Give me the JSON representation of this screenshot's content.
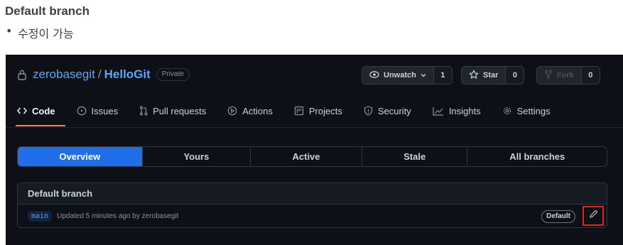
{
  "slide": {
    "heading": "Default branch",
    "bullet_marker": "•",
    "bullet": "수정이 가능"
  },
  "repo": {
    "owner": "zerobasegit",
    "separator": "/",
    "name": "HelloGit",
    "visibility": "Private",
    "lock_icon": "lock-icon"
  },
  "actions": {
    "watch": {
      "label": "Unwatch",
      "count": "1",
      "icon": "eye-icon"
    },
    "star": {
      "label": "Star",
      "count": "0",
      "icon": "star-icon"
    },
    "fork": {
      "label": "Fork",
      "count": "0",
      "icon": "fork-icon"
    }
  },
  "tabs": [
    {
      "label": "Code",
      "icon": "code-icon",
      "active": true
    },
    {
      "label": "Issues",
      "icon": "issue-icon"
    },
    {
      "label": "Pull requests",
      "icon": "pull-request-icon"
    },
    {
      "label": "Actions",
      "icon": "play-icon"
    },
    {
      "label": "Projects",
      "icon": "project-icon"
    },
    {
      "label": "Security",
      "icon": "shield-icon"
    },
    {
      "label": "Insights",
      "icon": "graph-icon"
    },
    {
      "label": "Settings",
      "icon": "gear-icon"
    }
  ],
  "branch_filters": [
    {
      "label": "Overview",
      "active": true
    },
    {
      "label": "Yours"
    },
    {
      "label": "Active"
    },
    {
      "label": "Stale"
    },
    {
      "label": "All branches"
    }
  ],
  "default_branch": {
    "header": "Default branch",
    "branch_name": "main",
    "updated": "Updated 5 minutes ago by zerobasegit",
    "badge": "Default",
    "edit_icon": "pencil-icon"
  },
  "colors": {
    "background": "#0d1117",
    "link": "#58a6ff",
    "active_tab_underline": "#f78166",
    "active_filter": "#1f6feb",
    "highlight_box": "#e5231b"
  }
}
